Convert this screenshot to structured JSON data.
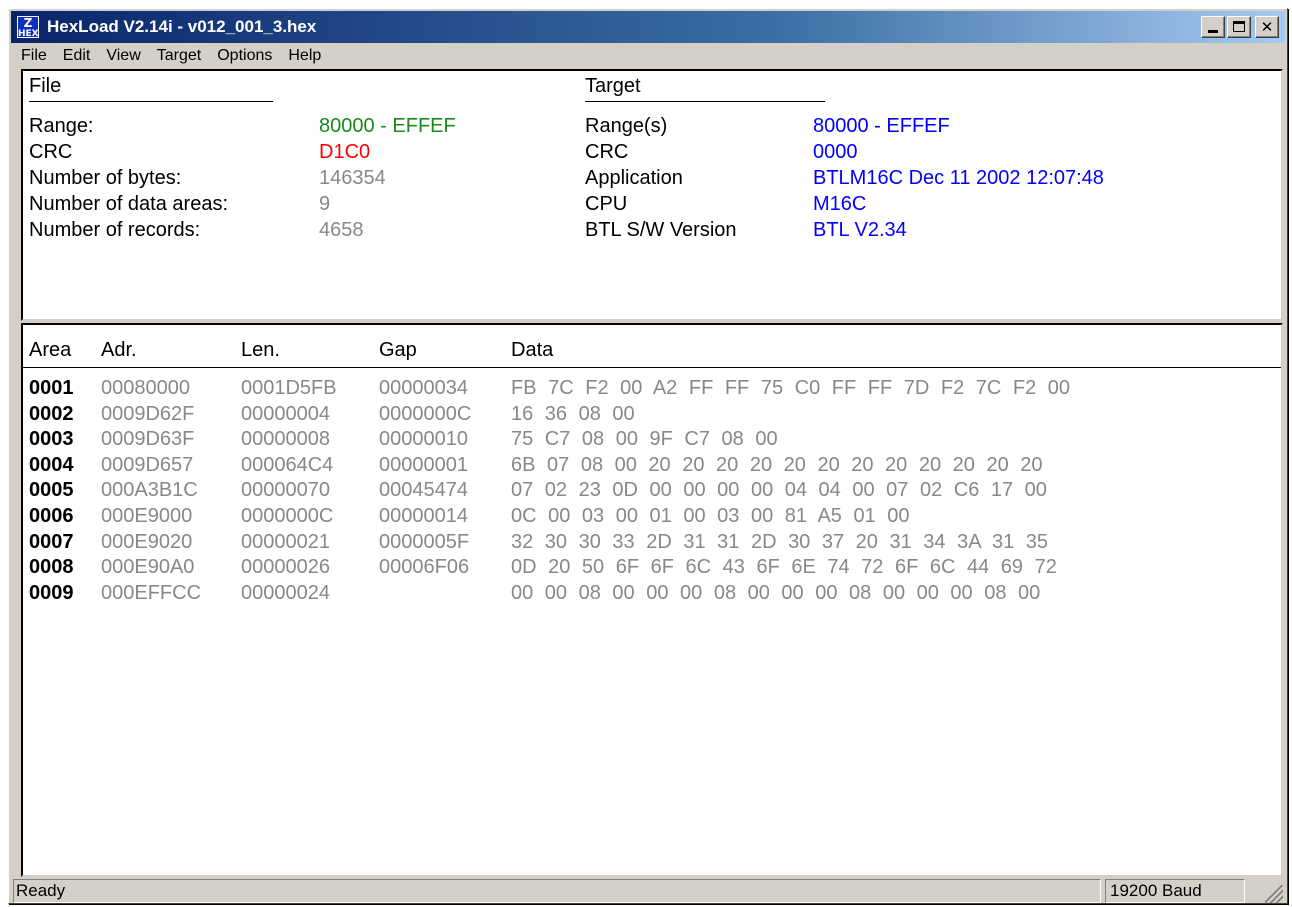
{
  "window": {
    "title": "HexLoad V2.14i - v012_001_3.hex",
    "icon_text_top": "Z",
    "icon_text_bottom": "HEX",
    "icon": "hexload-app-icon"
  },
  "menu": [
    "File",
    "Edit",
    "View",
    "Target",
    "Options",
    "Help"
  ],
  "file_info": {
    "heading": "File",
    "rows": [
      {
        "label": "Range:",
        "value": "80000 - EFFEF",
        "color": "#1a8a1a"
      },
      {
        "label": "CRC",
        "value": "D1C0",
        "color": "#ff0000"
      },
      {
        "label": "Number of bytes:",
        "value": "146354",
        "color": "#888888"
      },
      {
        "label": "Number of data areas:",
        "value": "9",
        "color": "#888888"
      },
      {
        "label": "Number of records:",
        "value": "4658",
        "color": "#888888"
      }
    ]
  },
  "target_info": {
    "heading": "Target",
    "rows": [
      {
        "label": "Range(s)",
        "value": "80000 - EFFEF",
        "color": "#0000ff"
      },
      {
        "label": "CRC",
        "value": "0000",
        "color": "#0000ff"
      },
      {
        "label": "Application",
        "value": "BTLM16C Dec 11 2002 12:07:48",
        "color": "#0000ff"
      },
      {
        "label": "CPU",
        "value": "M16C",
        "color": "#0000ff"
      },
      {
        "label": "BTL S/W Version",
        "value": "BTL V2.34",
        "color": "#0000ff"
      }
    ]
  },
  "table": {
    "headers": {
      "area": "Area",
      "adr": "Adr.",
      "len": "Len.",
      "gap": "Gap",
      "data": "Data"
    },
    "rows": [
      {
        "area": "0001",
        "adr": "00080000",
        "len": "0001D5FB",
        "gap": "00000034",
        "data": "FB 7C F2 00 A2 FF FF 75 C0 FF FF 7D F2 7C F2 00"
      },
      {
        "area": "0002",
        "adr": "0009D62F",
        "len": "00000004",
        "gap": "0000000C",
        "data": "16 36 08 00"
      },
      {
        "area": "0003",
        "adr": "0009D63F",
        "len": "00000008",
        "gap": "00000010",
        "data": "75 C7 08 00 9F C7 08 00"
      },
      {
        "area": "0004",
        "adr": "0009D657",
        "len": "000064C4",
        "gap": "00000001",
        "data": "6B 07 08 00 20 20 20 20 20 20 20 20 20 20 20 20"
      },
      {
        "area": "0005",
        "adr": "000A3B1C",
        "len": "00000070",
        "gap": "00045474",
        "data": "07 02 23 0D 00 00 00 00 04 04 00 07 02 C6 17 00"
      },
      {
        "area": "0006",
        "adr": "000E9000",
        "len": "0000000C",
        "gap": "00000014",
        "data": "0C 00 03 00 01 00 03 00 81 A5 01 00"
      },
      {
        "area": "0007",
        "adr": "000E9020",
        "len": "00000021",
        "gap": "0000005F",
        "data": "32 30 30 33 2D 31 31 2D 30 37 20 31 34 3A 31 35"
      },
      {
        "area": "0008",
        "adr": "000E90A0",
        "len": "00000026",
        "gap": "00006F06",
        "data": "0D 20 50 6F 6F 6C 43 6F 6E 74 72 6F 6C 44 69 72"
      },
      {
        "area": "0009",
        "adr": "000EFFCC",
        "len": "00000024",
        "gap": "",
        "data": "00 00 08 00 00 00 08 00 00 00 08 00 00 00 08 00"
      }
    ]
  },
  "status": {
    "text": "Ready",
    "baud": "19200 Baud"
  }
}
